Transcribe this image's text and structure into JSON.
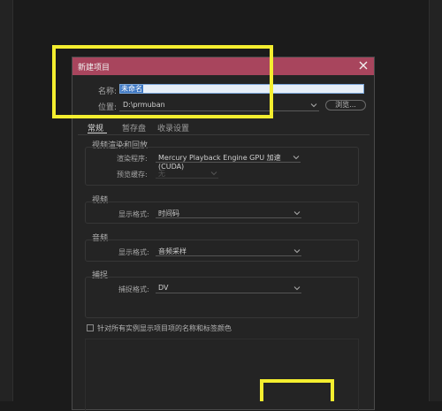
{
  "dialog": {
    "title": "新建项目",
    "name_label": "名称:",
    "name_value": "未命名",
    "location_label": "位置:",
    "location_value": "D:\\prmuban",
    "browse_label": "浏览..."
  },
  "tabs": [
    "常规",
    "暂存盘",
    "收录设置"
  ],
  "video_render": {
    "title": "视频渲染和回放",
    "renderer_label": "渲染程序:",
    "renderer_value": "Mercury Playback Engine GPU 加速 (CUDA)",
    "preview_cache_label": "预览缓存:",
    "preview_cache_value": "无"
  },
  "video": {
    "title": "视频",
    "display_format_label": "显示格式:",
    "display_format_value": "时间码"
  },
  "audio": {
    "title": "音频",
    "display_format_label": "显示格式:",
    "display_format_value": "音频采样"
  },
  "capture": {
    "title": "捕捉",
    "capture_format_label": "捕捉格式:",
    "capture_format_value": "DV"
  },
  "checkbox_label": "针对所有实例显示项目项的名称和标签颜色",
  "colors": {
    "titlebar": "#a8455d",
    "highlight": "#f4ee2f",
    "background": "#242424"
  }
}
